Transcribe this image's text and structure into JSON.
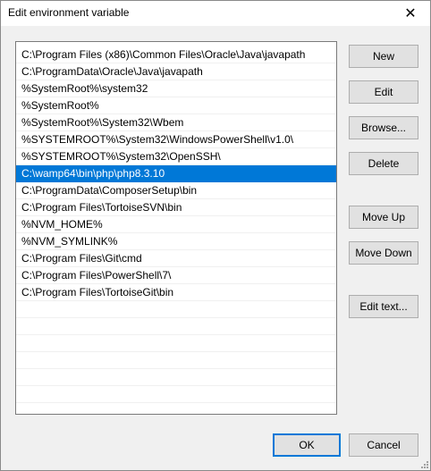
{
  "dialog": {
    "title": "Edit environment variable",
    "close_glyph": "✕"
  },
  "list": {
    "selected_index": 7,
    "items": [
      "C:\\Program Files (x86)\\Common Files\\Oracle\\Java\\javapath",
      "C:\\ProgramData\\Oracle\\Java\\javapath",
      "%SystemRoot%\\system32",
      "%SystemRoot%",
      "%SystemRoot%\\System32\\Wbem",
      "%SYSTEMROOT%\\System32\\WindowsPowerShell\\v1.0\\",
      "%SYSTEMROOT%\\System32\\OpenSSH\\",
      "C:\\wamp64\\bin\\php\\php8.3.10",
      "C:\\ProgramData\\ComposerSetup\\bin",
      "C:\\Program Files\\TortoiseSVN\\bin",
      "%NVM_HOME%",
      "%NVM_SYMLINK%",
      "C:\\Program Files\\Git\\cmd",
      "C:\\Program Files\\PowerShell\\7\\",
      "C:\\Program Files\\TortoiseGit\\bin",
      "",
      "",
      "",
      "",
      "",
      "",
      ""
    ]
  },
  "buttons": {
    "new": "New",
    "edit": "Edit",
    "browse": "Browse...",
    "delete": "Delete",
    "move_up": "Move Up",
    "move_down": "Move Down",
    "edit_text": "Edit text...",
    "ok": "OK",
    "cancel": "Cancel"
  },
  "colors": {
    "selection": "#0078d7",
    "default_button_border": "#0078d7"
  }
}
